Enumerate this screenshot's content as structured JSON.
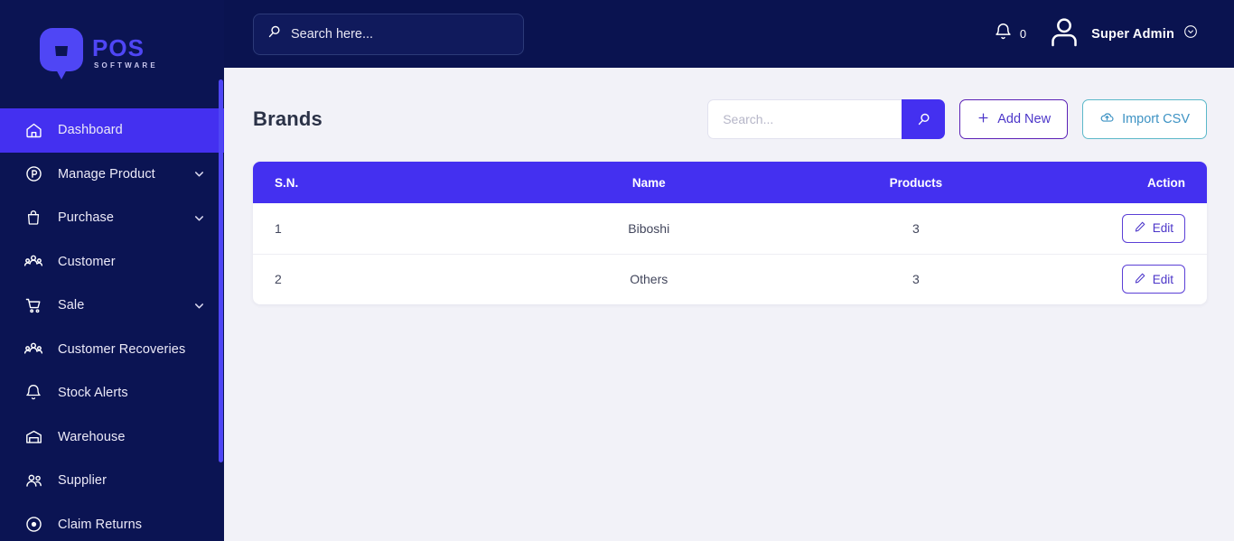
{
  "brand": {
    "logo_title": "POS",
    "logo_subtitle": "SOFTWARE",
    "accent_color": "#4430f0",
    "sidebar_color": "#0b1453",
    "header_color": "#0a1350"
  },
  "sidebar": {
    "items": [
      {
        "label": "Dashboard",
        "icon": "home-icon",
        "active": true,
        "expandable": false
      },
      {
        "label": "Manage Product",
        "icon": "circle-p-icon",
        "active": false,
        "expandable": true
      },
      {
        "label": "Purchase",
        "icon": "bag-icon",
        "active": false,
        "expandable": true
      },
      {
        "label": "Customer",
        "icon": "people-group-icon",
        "active": false,
        "expandable": false
      },
      {
        "label": "Sale",
        "icon": "cart-icon",
        "active": false,
        "expandable": true
      },
      {
        "label": "Customer Recoveries",
        "icon": "people-group-icon",
        "active": false,
        "expandable": false
      },
      {
        "label": "Stock Alerts",
        "icon": "bell-icon",
        "active": false,
        "expandable": false
      },
      {
        "label": "Warehouse",
        "icon": "warehouse-icon",
        "active": false,
        "expandable": false
      },
      {
        "label": "Supplier",
        "icon": "users-icon",
        "active": false,
        "expandable": false
      },
      {
        "label": "Claim Returns",
        "icon": "circle-dot-icon",
        "active": false,
        "expandable": false
      }
    ]
  },
  "topbar": {
    "search_placeholder": "Search here...",
    "notification_count": "0",
    "user_name": "Super Admin"
  },
  "page": {
    "title": "Brands",
    "search_placeholder": "Search...",
    "search_value": "",
    "add_new_label": "Add New",
    "import_csv_label": "Import CSV"
  },
  "table": {
    "columns": [
      "S.N.",
      "Name",
      "Products",
      "Action"
    ],
    "rows": [
      {
        "sn": "1",
        "name": "Biboshi",
        "products": "3",
        "action": "Edit"
      },
      {
        "sn": "2",
        "name": "Others",
        "products": "3",
        "action": "Edit"
      }
    ]
  }
}
